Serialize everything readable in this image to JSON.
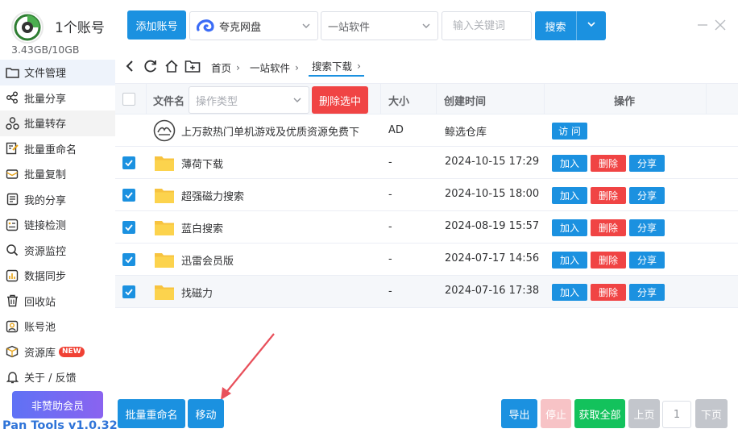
{
  "account": {
    "title": "1个账号",
    "quota": "3.43GB/10GB"
  },
  "sidebar": {
    "items": [
      {
        "label": "文件管理",
        "icon": "folder-icon"
      },
      {
        "label": "批量分享",
        "icon": "share-icon"
      },
      {
        "label": "批量转存",
        "icon": "transfer-icon"
      },
      {
        "label": "批量重命名",
        "icon": "rename-icon"
      },
      {
        "label": "批量复制",
        "icon": "copy-icon"
      },
      {
        "label": "我的分享",
        "icon": "my-share-icon"
      },
      {
        "label": "链接检测",
        "icon": "link-check-icon"
      },
      {
        "label": "资源监控",
        "icon": "monitor-icon"
      },
      {
        "label": "数据同步",
        "icon": "sync-icon"
      },
      {
        "label": "回收站",
        "icon": "trash-icon"
      },
      {
        "label": "账号池",
        "icon": "pool-icon"
      },
      {
        "label": "资源库",
        "icon": "library-icon",
        "badge": "NEW"
      },
      {
        "label": "关于 / 反馈",
        "icon": "bell-icon"
      }
    ],
    "vip_label": "非赞助会员",
    "version": "Pan Tools v1.0.32"
  },
  "toolbar": {
    "add_account": "添加账号",
    "drive": "夸克网盘",
    "site": "一站软件",
    "keyword_placeholder": "输入关键词",
    "search": "搜索"
  },
  "breadcrumb": [
    "首页",
    "一站软件",
    "搜索下载"
  ],
  "table": {
    "headers": {
      "name": "文件名",
      "size": "大小",
      "ctime": "创建时间",
      "ops": "操作"
    },
    "type_placeholder": "操作类型",
    "delete_selected": "删除选中",
    "rows": [
      {
        "name": "上万款热门单机游戏及优质资源免费下",
        "size": "AD",
        "ctime": "鲸选仓库",
        "checked": false,
        "kind": "ad",
        "action": "访 问"
      },
      {
        "name": "薄荷下载",
        "size": "-",
        "ctime": "2024-10-15 17:29",
        "checked": true,
        "kind": "folder"
      },
      {
        "name": "超强磁力搜索",
        "size": "-",
        "ctime": "2024-10-15 18:00",
        "checked": true,
        "kind": "folder"
      },
      {
        "name": "蓝白搜索",
        "size": "-",
        "ctime": "2024-08-19 15:57",
        "checked": true,
        "kind": "folder"
      },
      {
        "name": "迅雷会员版",
        "size": "-",
        "ctime": "2024-07-17 14:56",
        "checked": true,
        "kind": "folder"
      },
      {
        "name": "找磁力",
        "size": "-",
        "ctime": "2024-07-16 17:38",
        "checked": true,
        "kind": "folder"
      }
    ],
    "row_actions": {
      "add": "加入",
      "delete": "删除",
      "share": "分享"
    }
  },
  "bottom": {
    "batch_rename": "批量重命名",
    "move": "移动",
    "export": "导出",
    "stop": "停止",
    "fetch_all": "获取全部",
    "prev": "上页",
    "page": "1",
    "next": "下页"
  },
  "colors": {
    "primary": "#1b91e0",
    "danger": "#f04444",
    "success": "#13c25c",
    "annotation": "#e8505b"
  }
}
